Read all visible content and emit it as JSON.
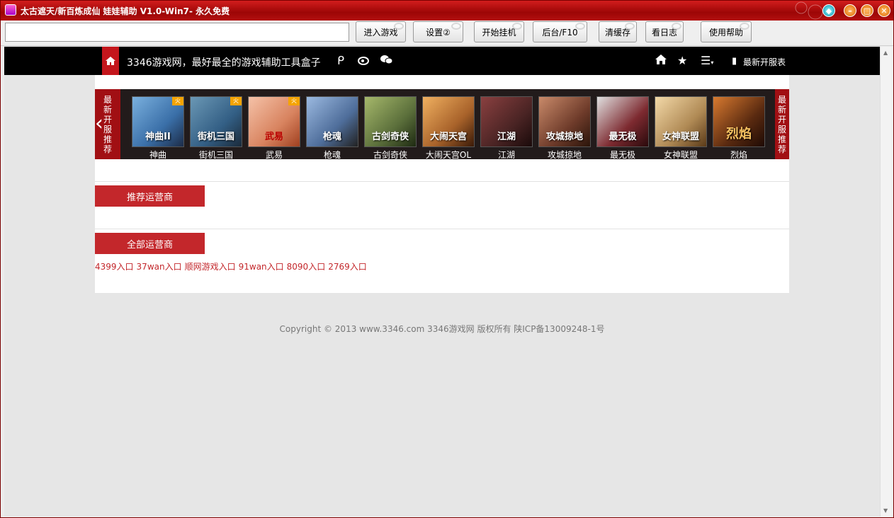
{
  "window": {
    "title": "太古遮天/新百炼成仙 娃娃辅助 V1.0-Win7- 永久免费",
    "minimize_icon": "minimize-icon",
    "maximize_icon": "maximize-icon",
    "close_icon": "close-icon",
    "skin_icon": "skin-icon"
  },
  "toolbar": {
    "url_value": "",
    "buttons": [
      {
        "label": "进入游戏"
      },
      {
        "label": "设置②"
      },
      {
        "label": "开始挂机"
      },
      {
        "label": "后台/F10"
      },
      {
        "label": "清缓存"
      },
      {
        "label": "看日志"
      },
      {
        "label": "使用帮助"
      }
    ]
  },
  "topnav": {
    "title": "3346游戏网，最好最全的游戏辅助工具盒子",
    "newest_servers": "最新开服表"
  },
  "slider": {
    "left_tag": "最新开服推荐",
    "right_tag": "最新开服推荐",
    "games": [
      {
        "name": "神曲",
        "thumb_text": "神曲II",
        "hot": "火",
        "color": "#3a6fa8"
      },
      {
        "name": "街机三国",
        "thumb_text": "街机三国",
        "hot": "火",
        "color": "#335f85"
      },
      {
        "name": "武易",
        "thumb_text": "武易",
        "hot": "火",
        "color": "#d8835f"
      },
      {
        "name": "枪魂",
        "thumb_text": "枪魂",
        "hot": "",
        "color": "#4e6d9a"
      },
      {
        "name": "古剑奇侠",
        "thumb_text": "古剑奇侠",
        "hot": "",
        "color": "#5b6f3b"
      },
      {
        "name": "大闹天宫OL",
        "thumb_text": "大闹天宫",
        "hot": "",
        "color": "#a8622a"
      },
      {
        "name": "江湖",
        "thumb_text": "江湖",
        "hot": "",
        "color": "#4a2424"
      },
      {
        "name": "攻城掠地",
        "thumb_text": "攻城掠地",
        "hot": "",
        "color": "#6e3b2a"
      },
      {
        "name": "最无极",
        "thumb_text": "最无极",
        "hot": "",
        "color": "#7d2a30"
      },
      {
        "name": "女神联盟",
        "thumb_text": "女神联盟",
        "hot": "",
        "color": "#b08a55"
      },
      {
        "name": "烈焰",
        "thumb_text": "烈焰",
        "hot": "",
        "color": "#5a2a10"
      }
    ]
  },
  "sections": {
    "recommended": "推荐运营商",
    "all": "全部运营商"
  },
  "operator_links": [
    "4399入口",
    "37wan入口",
    "顺网游戏入口",
    "91wan入口",
    "8090入口",
    "2769入口"
  ],
  "footer": "Copyright © 2013 www.3346.com 3346游戏网 版权所有 陕ICP备13009248-1号"
}
